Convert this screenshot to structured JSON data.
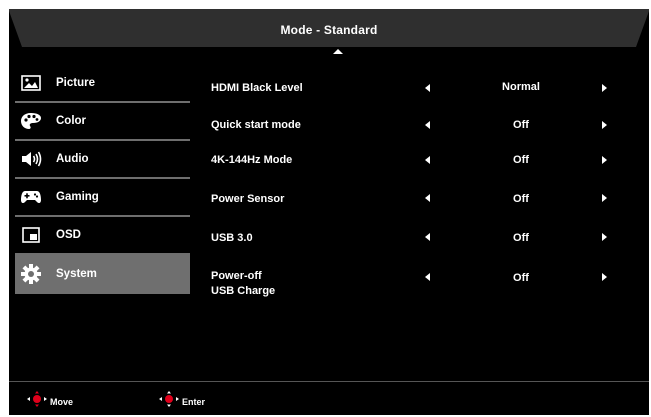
{
  "header": {
    "title": "Mode - Standard"
  },
  "sidebar": {
    "items": [
      {
        "label": "Picture",
        "icon": "picture-icon",
        "active": false
      },
      {
        "label": "Color",
        "icon": "palette-icon",
        "active": false
      },
      {
        "label": "Audio",
        "icon": "speaker-icon",
        "active": false
      },
      {
        "label": "Gaming",
        "icon": "gamepad-icon",
        "active": false
      },
      {
        "label": "OSD",
        "icon": "osd-icon",
        "active": false
      },
      {
        "label": "System",
        "icon": "gear-icon",
        "active": true
      }
    ]
  },
  "settings": [
    {
      "label": "HDMI Black Level",
      "value": "Normal"
    },
    {
      "label": "Quick start mode",
      "value": "Off"
    },
    {
      "label": "4K-144Hz Mode",
      "value": "Off"
    },
    {
      "label": "Power Sensor",
      "value": "Off"
    },
    {
      "label": "USB 3.0",
      "value": "Off"
    },
    {
      "label_line1": "Power-off",
      "label_line2": "USB Charge",
      "value": "Off"
    }
  ],
  "footer": {
    "move_label": "Move",
    "enter_label": "Enter"
  },
  "colors": {
    "background": "#000000",
    "header": "#2f2f2f",
    "active_item": "#6f6f6f",
    "joystick_red": "#e0001b"
  }
}
